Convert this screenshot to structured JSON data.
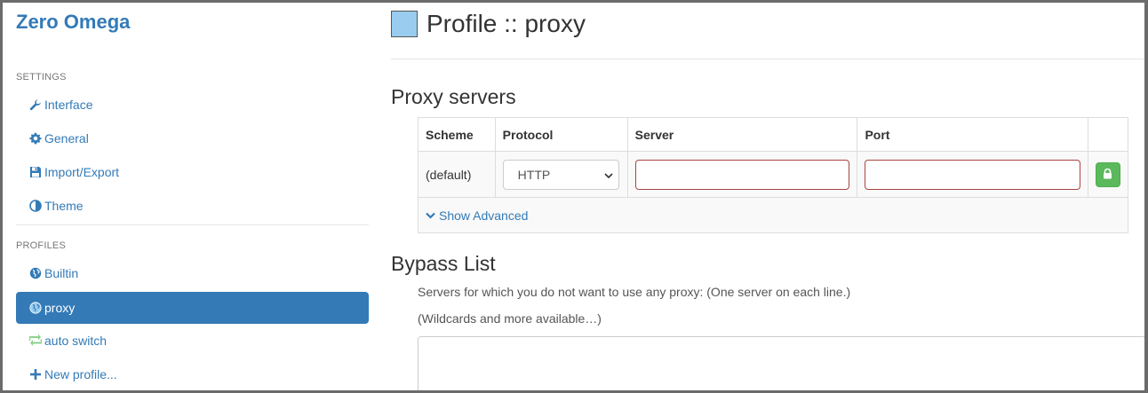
{
  "app": {
    "brand": "Zero Omega"
  },
  "sidebar": {
    "settings_title": "SETTINGS",
    "settings_items": [
      {
        "label": "Interface",
        "icon": "wrench-icon"
      },
      {
        "label": "General",
        "icon": "gear-icon"
      },
      {
        "label": "Import/Export",
        "icon": "floppy-icon"
      },
      {
        "label": "Theme",
        "icon": "contrast-icon"
      }
    ],
    "profiles_title": "PROFILES",
    "profile_items": [
      {
        "label": "Builtin",
        "icon": "globe-icon"
      },
      {
        "label": "proxy",
        "icon": "globe-icon",
        "active": true
      },
      {
        "label": "auto switch",
        "icon": "retweet-icon"
      },
      {
        "label": "New profile...",
        "icon": "plus-icon"
      }
    ]
  },
  "main": {
    "title": "Profile :: proxy",
    "profile_color": "#99ccee",
    "proxy_servers": {
      "heading": "Proxy servers",
      "columns": [
        "Scheme",
        "Protocol",
        "Server",
        "Port"
      ],
      "row": {
        "scheme": "(default)",
        "protocol": "HTTP",
        "server": "",
        "port": ""
      },
      "show_advanced": "Show Advanced"
    },
    "bypass": {
      "heading": "Bypass List",
      "help": "Servers for which you do not want to use any proxy: (One server on each line.)",
      "link": "(Wildcards and more available…)",
      "value": ""
    }
  },
  "colors": {
    "accent": "#337ab7",
    "success": "#5cb85c",
    "error_border": "#a94442"
  }
}
